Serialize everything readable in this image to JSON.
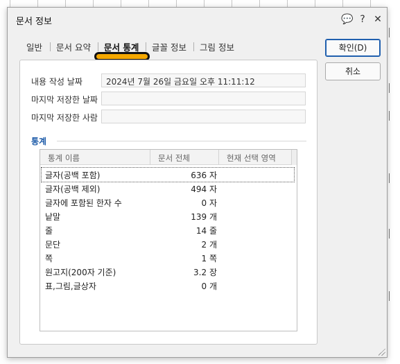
{
  "dialog": {
    "title": "문서 정보",
    "title_buttons": {
      "comment": "💬",
      "help": "?",
      "close": "✕"
    }
  },
  "tabs": [
    {
      "label": "일반"
    },
    {
      "label": "문서 요약"
    },
    {
      "label": "문서 통계",
      "active": true
    },
    {
      "label": "글꼴 정보"
    },
    {
      "label": "그림 정보"
    }
  ],
  "info": {
    "created_label": "내용 작성 날짜",
    "created_value": "2024년 7월 26일 금요일 오후 11:11:12",
    "last_saved_label": "마지막 저장한 날짜",
    "last_saved_value": "",
    "last_saved_by_label": "마지막 저장한 사람",
    "last_saved_by_value": ""
  },
  "stats": {
    "heading": "통계",
    "columns": [
      "통계 이름",
      "문서 전체",
      "현재 선택 영역"
    ],
    "rows": [
      {
        "name": "글자(공백 포함)",
        "total": "636 자",
        "selection": ""
      },
      {
        "name": "글자(공백 제외)",
        "total": "494 자",
        "selection": ""
      },
      {
        "name": "글자에 포함된 한자 수",
        "total": "0 자",
        "selection": ""
      },
      {
        "name": "낱말",
        "total": "139 개",
        "selection": ""
      },
      {
        "name": "줄",
        "total": "14 줄",
        "selection": ""
      },
      {
        "name": "문단",
        "total": "2 개",
        "selection": ""
      },
      {
        "name": "쪽",
        "total": "1 쪽",
        "selection": ""
      },
      {
        "name": "원고지(200자 기준)",
        "total": "3.2 장",
        "selection": ""
      },
      {
        "name": "표,그림,글상자",
        "total": "0 개",
        "selection": ""
      }
    ]
  },
  "buttons": {
    "ok": "확인(D)",
    "cancel": "취소"
  },
  "colors": {
    "accent": "#1f5fae",
    "tab_highlight": "#f5a800",
    "section_heading": "#1c5aa8"
  }
}
